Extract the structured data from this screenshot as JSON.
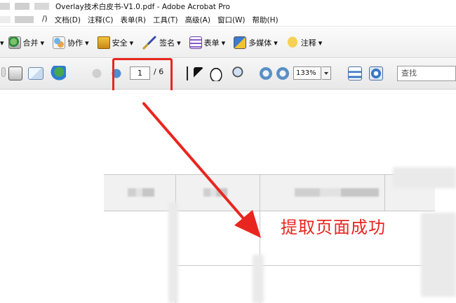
{
  "window": {
    "title": "Overlay技术白皮书-V1.0.pdf - Adobe Acrobat Pro"
  },
  "menu": {
    "items": [
      "文档(D)",
      "注释(C)",
      "表单(R)",
      "工具(T)",
      "高级(A)",
      "窗口(W)",
      "帮助(H)"
    ],
    "partial_first": "/)"
  },
  "toolbar_tasks": {
    "items": [
      {
        "label": "合并",
        "icon": "combine-icon"
      },
      {
        "label": "协作",
        "icon": "collaborate-icon"
      },
      {
        "label": "安全",
        "icon": "lock-icon"
      },
      {
        "label": "签名",
        "icon": "pen-icon"
      },
      {
        "label": "表单",
        "icon": "form-icon"
      },
      {
        "label": "多媒体",
        "icon": "multimedia-icon"
      },
      {
        "label": "注释",
        "icon": "comment-icon"
      }
    ],
    "dropdown_glyph": "▾"
  },
  "navigation": {
    "current_page": "1",
    "total_pages": "/ 6"
  },
  "zoom": {
    "value": "133%"
  },
  "search": {
    "placeholder": "查找"
  },
  "annotation": {
    "caption": "提取页面成功",
    "accent_color": "#e8261f"
  }
}
